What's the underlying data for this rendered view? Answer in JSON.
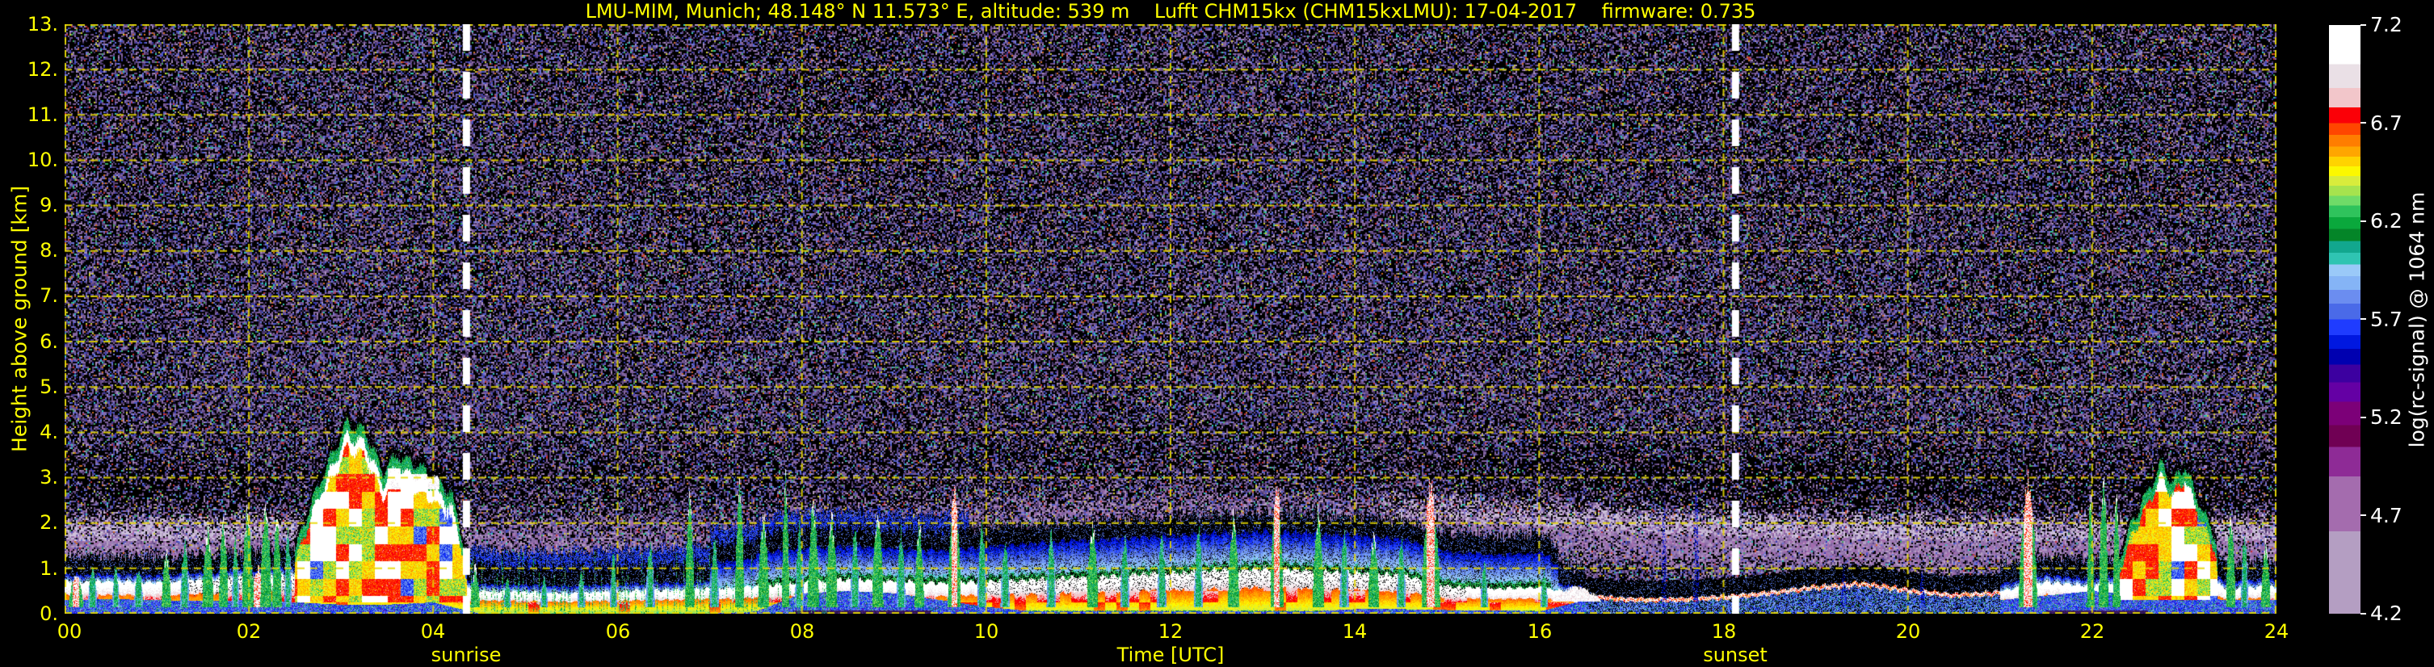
{
  "title": "LMU-MIM, Munich; 48.148° N 11.573° E, altitude: 539 m    Lufft CHM15kx (CHM15kxLMU): 17-04-2017    firmware: 0.735",
  "axes": {
    "ylabel": "Height above ground [km]",
    "xlabel": "Time [UTC]",
    "yticks": [
      "13.",
      "12.",
      "11.",
      "10.",
      "9.",
      "8.",
      "7.",
      "6.",
      "5.",
      "4.",
      "3.",
      "2.",
      "1.",
      "0."
    ],
    "xticks": [
      "00",
      "02",
      "04",
      "06",
      "08",
      "10",
      "12",
      "14",
      "16",
      "18",
      "20",
      "22",
      "24"
    ],
    "sunrise_label": "sunrise",
    "sunset_label": "sunset"
  },
  "colorbar": {
    "label": "log(rc-signal) @ 1064 nm",
    "ticks": [
      "7.2",
      "6.7",
      "6.2",
      "5.7",
      "5.2",
      "4.7",
      "4.2"
    ]
  },
  "colors": {
    "axis_text": "#ffff00",
    "grid": "#e6d800",
    "sun_line": "#ffffff",
    "background": "#000000"
  },
  "chart_data": {
    "type": "heatmap",
    "title": "LMU-MIM, Munich; 48.148° N 11.573° E, altitude: 539 m  Lufft CHM15kx (CHM15kxLMU): 17-04-2017  firmware: 0.735",
    "xlabel": "Time [UTC]",
    "ylabel": "Height above ground [km]",
    "x_range_hours": [
      0,
      24
    ],
    "y_range_km": [
      0,
      13
    ],
    "x_tick_step_hours": 2,
    "y_tick_step_km": 1,
    "grid": true,
    "value_label": "log(rc-signal) @ 1064 nm",
    "value_range": [
      4.2,
      7.2
    ],
    "colorbar_tick_values": [
      7.2,
      6.7,
      6.2,
      5.7,
      5.2,
      4.7,
      4.2
    ],
    "sunrise_utc": 4.36,
    "sunset_utc": 18.13,
    "palette": [
      [
        4.2,
        "#b49ec2"
      ],
      [
        4.62,
        "#a46cae"
      ],
      [
        4.9,
        "#8e2b96"
      ],
      [
        5.05,
        "#700054"
      ],
      [
        5.16,
        "#7c0078"
      ],
      [
        5.28,
        "#6400a4"
      ],
      [
        5.38,
        "#3c00a0"
      ],
      [
        5.47,
        "#0000b0"
      ],
      [
        5.55,
        "#0018e0"
      ],
      [
        5.62,
        "#1f3cff"
      ],
      [
        5.7,
        "#4a6ae8"
      ],
      [
        5.78,
        "#6b8df0"
      ],
      [
        5.85,
        "#85b4f6"
      ],
      [
        5.92,
        "#9ac9f8"
      ],
      [
        5.98,
        "#2fc4b2"
      ],
      [
        6.04,
        "#12a78e"
      ],
      [
        6.1,
        "#048528"
      ],
      [
        6.16,
        "#0aa83c"
      ],
      [
        6.22,
        "#2fc35c"
      ],
      [
        6.28,
        "#6fdb68"
      ],
      [
        6.33,
        "#a6e34e"
      ],
      [
        6.38,
        "#d8ec3c"
      ],
      [
        6.43,
        "#fcf800"
      ],
      [
        6.48,
        "#ffd300"
      ],
      [
        6.53,
        "#ffa600"
      ],
      [
        6.58,
        "#ff7d00"
      ],
      [
        6.64,
        "#ff4600"
      ],
      [
        6.7,
        "#fb0007"
      ],
      [
        6.78,
        "#f2c6ca"
      ],
      [
        6.88,
        "#eae0e6"
      ],
      [
        7.0,
        "#ffffff"
      ]
    ],
    "bl": {
      "t_step_hours": 0.5,
      "top_km": [
        0.7,
        0.72,
        0.68,
        0.75,
        0.8,
        0.85,
        1.1,
        1.0,
        0.9,
        0.5,
        0.48,
        0.45,
        0.5,
        0.52,
        0.55,
        0.6,
        0.7,
        0.75,
        0.72,
        0.68,
        0.7,
        0.75,
        0.8,
        0.85,
        0.9,
        0.95,
        1.0,
        0.95,
        0.9,
        0.85,
        0.6,
        0.55,
        0.58,
        0.42,
        0.35,
        0.35,
        0.4,
        0.5,
        0.62,
        0.7,
        0.55,
        0.45,
        0.5,
        0.7,
        0.6,
        0.75,
        0.85,
        0.55,
        0.6
      ],
      "intensity": [
        0.85,
        0.8,
        0.85,
        0.9,
        0.9,
        0.95,
        1.0,
        1.0,
        0.95,
        0.78,
        0.72,
        0.7,
        0.72,
        0.72,
        0.75,
        0.8,
        0.85,
        0.82,
        0.8,
        0.8,
        0.9,
        0.95,
        1.0,
        1.0,
        1.0,
        1.0,
        1.0,
        1.0,
        1.0,
        0.95,
        0.9,
        0.85,
        0.88,
        0.55,
        0.38,
        0.32,
        0.35,
        0.4,
        0.45,
        0.45,
        0.42,
        0.4,
        0.55,
        0.8,
        0.7,
        0.85,
        0.9,
        0.72,
        0.75
      ],
      "blue_km": [
        0.3,
        0.32,
        0.3,
        0.28,
        0.3,
        0.25,
        0.2,
        0.2,
        0.25,
        0.0,
        0.0,
        0.0,
        0.0,
        0.0,
        0.0,
        0.05,
        0.45,
        0.5,
        0.45,
        0.3,
        0.15,
        0.05,
        0.05,
        0.05,
        0.05,
        0.05,
        0.05,
        0.05,
        0.1,
        0.1,
        0.08,
        0.08,
        0.05,
        0.3,
        0.5,
        0.5,
        0.45,
        0.4,
        0.4,
        0.4,
        0.4,
        0.35,
        0.3,
        0.4,
        0.5,
        0.4,
        0.35,
        0.3,
        0.3
      ],
      "haze": [
        0.95,
        0.95,
        0.9,
        0.85,
        0.8,
        0.7,
        0.55,
        0.55,
        0.65,
        0.75,
        0.7,
        0.6,
        0.5,
        0.45,
        0.42,
        0.4,
        0.4,
        0.4,
        0.4,
        0.4,
        0.45,
        0.48,
        0.5,
        0.5,
        0.5,
        0.5,
        0.5,
        0.52,
        0.55,
        0.6,
        0.7,
        0.75,
        0.8,
        0.85,
        0.9,
        0.92,
        0.95,
        0.95,
        0.95,
        0.95,
        0.92,
        0.9,
        0.85,
        0.8,
        0.75,
        0.7,
        0.72,
        0.85,
        0.9
      ]
    },
    "spikes": [
      [
        0.12,
        0.9,
        0.08,
        2
      ],
      [
        0.3,
        1.1,
        0.05,
        0
      ],
      [
        0.55,
        1.05,
        0.04,
        0
      ],
      [
        0.8,
        1.0,
        0.05,
        0
      ],
      [
        1.1,
        1.45,
        0.05,
        1
      ],
      [
        1.3,
        1.6,
        0.05,
        0
      ],
      [
        1.55,
        1.95,
        0.06,
        1
      ],
      [
        1.72,
        2.15,
        0.05,
        1
      ],
      [
        1.85,
        1.7,
        0.04,
        0
      ],
      [
        1.98,
        2.35,
        0.06,
        1
      ],
      [
        2.1,
        1.0,
        0.12,
        2
      ],
      [
        2.18,
        2.5,
        0.06,
        1
      ],
      [
        2.3,
        2.2,
        0.05,
        1
      ],
      [
        2.42,
        1.9,
        0.04,
        0
      ],
      [
        4.45,
        1.05,
        0.05,
        1
      ],
      [
        4.8,
        0.8,
        0.04,
        0
      ],
      [
        5.2,
        0.85,
        0.04,
        0
      ],
      [
        5.6,
        0.95,
        0.04,
        0
      ],
      [
        5.95,
        1.35,
        0.04,
        0
      ],
      [
        6.35,
        1.55,
        0.05,
        0
      ],
      [
        6.78,
        2.6,
        0.05,
        1
      ],
      [
        7.05,
        1.65,
        0.05,
        0
      ],
      [
        7.32,
        2.85,
        0.05,
        1
      ],
      [
        7.58,
        2.25,
        0.06,
        1
      ],
      [
        7.82,
        3.1,
        0.04,
        1
      ],
      [
        7.97,
        1.95,
        0.05,
        0
      ],
      [
        8.12,
        2.6,
        0.06,
        1
      ],
      [
        8.32,
        2.25,
        0.06,
        1
      ],
      [
        8.57,
        1.9,
        0.05,
        0
      ],
      [
        8.82,
        2.4,
        0.06,
        1
      ],
      [
        9.07,
        1.85,
        0.05,
        0
      ],
      [
        9.27,
        2.05,
        0.05,
        1
      ],
      [
        9.65,
        2.9,
        0.07,
        2
      ],
      [
        9.95,
        2.1,
        0.05,
        0
      ],
      [
        10.2,
        1.65,
        0.05,
        0
      ],
      [
        10.7,
        1.85,
        0.05,
        0
      ],
      [
        11.15,
        2.05,
        0.06,
        1
      ],
      [
        11.5,
        1.75,
        0.05,
        0
      ],
      [
        11.9,
        1.7,
        0.05,
        0
      ],
      [
        12.3,
        1.95,
        0.05,
        0
      ],
      [
        12.68,
        2.2,
        0.06,
        1
      ],
      [
        13.15,
        2.95,
        0.07,
        2
      ],
      [
        13.6,
        2.35,
        0.06,
        1
      ],
      [
        13.88,
        1.85,
        0.05,
        0
      ],
      [
        14.2,
        1.75,
        0.06,
        1
      ],
      [
        14.5,
        1.65,
        0.05,
        0
      ],
      [
        14.82,
        2.95,
        0.1,
        2
      ],
      [
        15.4,
        1.15,
        0.04,
        0
      ],
      [
        16.05,
        0.95,
        0.04,
        0
      ],
      [
        16.4,
        0.62,
        0.3,
        4
      ],
      [
        17.35,
        2.9,
        0.03,
        3
      ],
      [
        17.7,
        3.4,
        0.03,
        3
      ],
      [
        19.3,
        1.05,
        0.03,
        3
      ],
      [
        20.15,
        1.1,
        0.03,
        3
      ],
      [
        21.3,
        3.1,
        0.1,
        2
      ],
      [
        21.98,
        2.65,
        0.04,
        1
      ],
      [
        22.12,
        3.05,
        0.05,
        1
      ],
      [
        22.26,
        2.75,
        0.04,
        1
      ],
      [
        23.5,
        2.25,
        0.05,
        1
      ],
      [
        23.65,
        1.85,
        0.04,
        0
      ],
      [
        23.88,
        1.65,
        0.05,
        1
      ]
    ],
    "clouds": [
      {
        "t0": 2.5,
        "t1": 4.35,
        "base": 0.25,
        "cap": true,
        "band": [
          3.5,
          4.25,
          2.75,
          3.2
        ],
        "keys": [
          [
            2.5,
            1.4
          ],
          [
            2.7,
            2.6
          ],
          [
            2.9,
            3.5
          ],
          [
            3.05,
            4.2
          ],
          [
            3.25,
            4.05
          ],
          [
            3.45,
            3.1
          ],
          [
            3.6,
            3.5
          ],
          [
            3.8,
            3.3
          ],
          [
            4.0,
            3.05
          ],
          [
            4.2,
            2.6
          ],
          [
            4.35,
            1.3
          ]
        ]
      },
      {
        "t0": 22.3,
        "t1": 23.35,
        "base": 0.3,
        "cap": false,
        "keys": [
          [
            22.3,
            1.3
          ],
          [
            22.45,
            2.1
          ],
          [
            22.6,
            2.7
          ],
          [
            22.75,
            3.3
          ],
          [
            22.88,
            2.85
          ],
          [
            23.0,
            3.3
          ],
          [
            23.12,
            2.6
          ],
          [
            23.35,
            1.6
          ]
        ]
      }
    ],
    "dark_ground_intervals": [
      [
        7.9,
        9.4
      ],
      [
        21.5,
        22.6
      ]
    ]
  }
}
